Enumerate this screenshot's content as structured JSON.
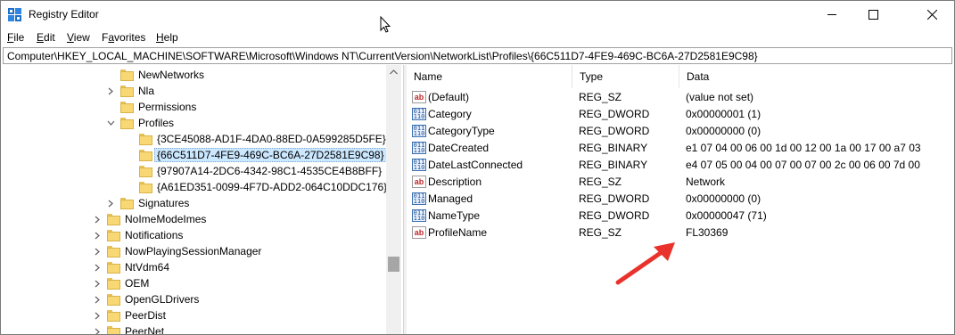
{
  "window": {
    "title": "Registry Editor"
  },
  "menu": {
    "file": {
      "first": "F",
      "rest": "ile"
    },
    "edit": {
      "first": "E",
      "rest": "dit"
    },
    "view": {
      "first": "V",
      "rest": "iew"
    },
    "favorites": {
      "first": "F",
      "pre": "",
      "mid": "a",
      "rest": "vorites"
    },
    "help": {
      "first": "H",
      "rest": "elp"
    }
  },
  "address": {
    "path": "Computer\\HKEY_LOCAL_MACHINE\\SOFTWARE\\Microsoft\\Windows NT\\CurrentVersion\\NetworkList\\Profiles\\{66C511D7-4FE9-469C-BC6A-27D2581E9C98}"
  },
  "tree": {
    "items": [
      {
        "label": "NewNetworks",
        "expander": "none"
      },
      {
        "label": "Nla",
        "expander": "collapsed"
      },
      {
        "label": "Permissions",
        "expander": "none"
      },
      {
        "label": "Profiles",
        "expander": "expanded"
      },
      {
        "label": "{3CE45088-AD1F-4DA0-88ED-0A599285D5FE}",
        "expander": "none"
      },
      {
        "label": "{66C511D7-4FE9-469C-BC6A-27D2581E9C98}",
        "expander": "none",
        "selected": true
      },
      {
        "label": "{97907A14-2DC6-4342-98C1-4535CE4B8BFF}",
        "expander": "none"
      },
      {
        "label": "{A61ED351-0099-4F7D-ADD2-064C10DDC176}",
        "expander": "none"
      },
      {
        "label": "Signatures",
        "expander": "collapsed"
      },
      {
        "label": "NoImeModeImes",
        "expander": "collapsed"
      },
      {
        "label": "Notifications",
        "expander": "collapsed"
      },
      {
        "label": "NowPlayingSessionManager",
        "expander": "collapsed"
      },
      {
        "label": "NtVdm64",
        "expander": "collapsed"
      },
      {
        "label": "OEM",
        "expander": "collapsed"
      },
      {
        "label": "OpenGLDrivers",
        "expander": "collapsed"
      },
      {
        "label": "PeerDist",
        "expander": "collapsed"
      },
      {
        "label": "PeerNet",
        "expander": "collapsed"
      }
    ]
  },
  "values": {
    "headers": {
      "name": "Name",
      "type": "Type",
      "data": "Data"
    },
    "rows": [
      {
        "icon": "string-value-icon",
        "name": "(Default)",
        "type": "REG_SZ",
        "data": "(value not set)"
      },
      {
        "icon": "binary-value-icon",
        "name": "Category",
        "type": "REG_DWORD",
        "data": "0x00000001 (1)"
      },
      {
        "icon": "binary-value-icon",
        "name": "CategoryType",
        "type": "REG_DWORD",
        "data": "0x00000000 (0)"
      },
      {
        "icon": "binary-value-icon",
        "name": "DateCreated",
        "type": "REG_BINARY",
        "data": "e1 07 04 00 06 00 1d 00 12 00 1a 00 17 00 a7 03"
      },
      {
        "icon": "binary-value-icon",
        "name": "DateLastConnected",
        "type": "REG_BINARY",
        "data": "e4 07 05 00 04 00 07 00 07 00 2c 00 06 00 7d 00"
      },
      {
        "icon": "string-value-icon",
        "name": "Description",
        "type": "REG_SZ",
        "data": "Network"
      },
      {
        "icon": "binary-value-icon",
        "name": "Managed",
        "type": "REG_DWORD",
        "data": "0x00000000 (0)"
      },
      {
        "icon": "binary-value-icon",
        "name": "NameType",
        "type": "REG_DWORD",
        "data": "0x00000047 (71)"
      },
      {
        "icon": "string-value-icon",
        "name": "ProfileName",
        "type": "REG_SZ",
        "data": "FL30369"
      }
    ]
  },
  "annotation": {
    "color": "#e8322b"
  }
}
